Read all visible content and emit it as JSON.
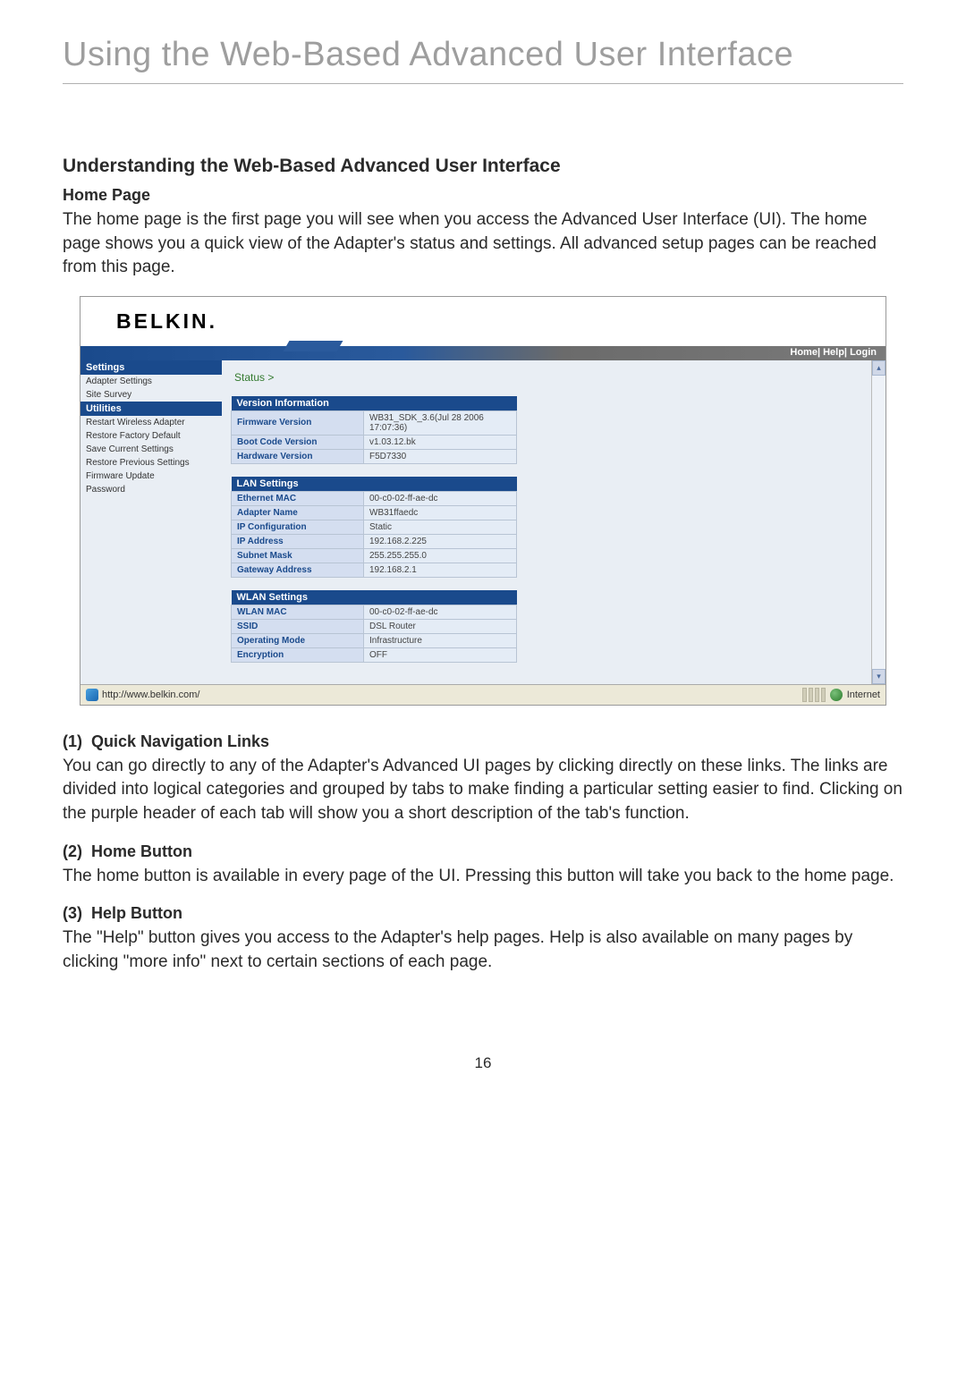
{
  "page_title": "Using the Web-Based Advanced User Interface",
  "section_heading": "Understanding the Web-Based Advanced User Interface",
  "home_page_heading": "Home Page",
  "home_page_text": "The home page is the first page you will see when you access the Advanced User Interface (UI). The home page shows you a quick view of the Adapter's status and settings. All advanced setup pages can be reached from this page.",
  "sections": [
    {
      "num": "(1)",
      "title": "Quick Navigation Links",
      "text": "You can go directly to any of the Adapter's Advanced UI pages by clicking directly on these links. The links are divided into logical categories and grouped by tabs to make finding a particular setting easier to find. Clicking on the purple header of each tab will show you a short description of the tab's function."
    },
    {
      "num": "(2)",
      "title": "Home Button",
      "text": "The home button is available in every page of the UI. Pressing this button will take you back to the home page."
    },
    {
      "num": "(3)",
      "title": "Help Button",
      "text": "The \"Help\" button gives you access to the Adapter's help pages. Help is also available on many pages by clicking \"more info\" next to certain sections of each page."
    }
  ],
  "page_number": "16",
  "screenshot": {
    "logo": "BELKIN.",
    "top_links": {
      "home": "Home",
      "help": "Help",
      "login": "Login"
    },
    "sidebar": {
      "settings_header": "Settings",
      "settings_items": [
        "Adapter Settings",
        "Site Survey"
      ],
      "utilities_header": "Utilities",
      "utilities_items": [
        "Restart Wireless Adapter",
        "Restore Factory Default",
        "Save Current Settings",
        "Restore Previous Settings",
        "Firmware Update",
        "Password"
      ]
    },
    "breadcrumb": "Status >",
    "tables": {
      "version": {
        "header": "Version Information",
        "rows": [
          {
            "label": "Firmware Version",
            "value": "WB31_SDK_3.6(Jul 28 2006 17:07:36)"
          },
          {
            "label": "Boot Code Version",
            "value": "v1.03.12.bk"
          },
          {
            "label": "Hardware Version",
            "value": "F5D7330"
          }
        ]
      },
      "lan": {
        "header": "LAN Settings",
        "rows": [
          {
            "label": "Ethernet MAC",
            "value": "00-c0-02-ff-ae-dc"
          },
          {
            "label": "Adapter Name",
            "value": "WB31ffaedc"
          },
          {
            "label": "IP Configuration",
            "value": "Static"
          },
          {
            "label": "IP Address",
            "value": "192.168.2.225"
          },
          {
            "label": "Subnet Mask",
            "value": "255.255.255.0"
          },
          {
            "label": "Gateway Address",
            "value": "192.168.2.1"
          }
        ]
      },
      "wlan": {
        "header": "WLAN Settings",
        "rows": [
          {
            "label": "WLAN MAC",
            "value": "00-c0-02-ff-ae-dc"
          },
          {
            "label": "SSID",
            "value": "DSL Router"
          },
          {
            "label": "Operating Mode",
            "value": "Infrastructure"
          },
          {
            "label": "Encryption",
            "value": "OFF"
          }
        ]
      }
    },
    "status_bar": {
      "url": "http://www.belkin.com/",
      "zone": "Internet"
    }
  }
}
